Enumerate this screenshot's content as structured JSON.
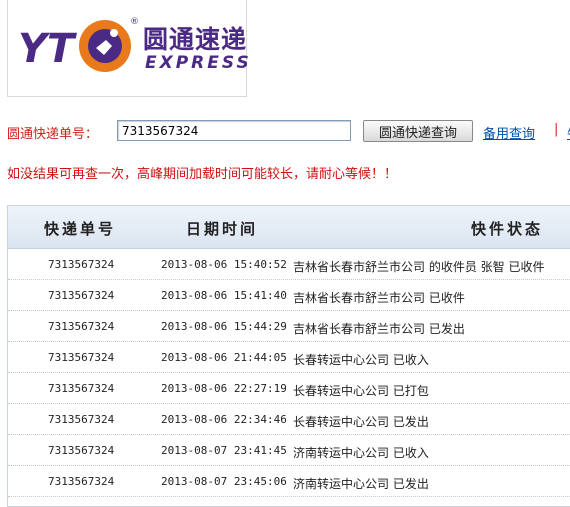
{
  "brand": {
    "logo_mark": "YT",
    "name_cn": "圆通速递",
    "name_en": "EXPRESS",
    "colors": {
      "purple": "#4b2a86",
      "orange": "#e87a1b"
    }
  },
  "search": {
    "label": "圆通快递单号：",
    "value": "7313567324",
    "button_label": "圆通快递查询",
    "backup_link": "备用查询",
    "separator": "|",
    "extra_link": "牛"
  },
  "notice": "如没结果可再查一次，高峰期间加载时间可能较长，请耐心等候！！",
  "table": {
    "headers": [
      "快递单号",
      "日期时间",
      "快件状态"
    ],
    "rows": [
      {
        "no": "7313567324",
        "time": "2013-08-06 15:40:52",
        "status": "吉林省长春市舒兰市公司 的收件员 张智 已收件"
      },
      {
        "no": "7313567324",
        "time": "2013-08-06 15:41:40",
        "status": "吉林省长春市舒兰市公司 已收件"
      },
      {
        "no": "7313567324",
        "time": "2013-08-06 15:44:29",
        "status": "吉林省长春市舒兰市公司 已发出"
      },
      {
        "no": "7313567324",
        "time": "2013-08-06 21:44:05",
        "status": "长春转运中心公司 已收入"
      },
      {
        "no": "7313567324",
        "time": "2013-08-06 22:27:19",
        "status": "长春转运中心公司 已打包"
      },
      {
        "no": "7313567324",
        "time": "2013-08-06 22:34:46",
        "status": "长春转运中心公司 已发出"
      },
      {
        "no": "7313567324",
        "time": "2013-08-07 23:41:45",
        "status": "济南转运中心公司 已收入"
      },
      {
        "no": "7313567324",
        "time": "2013-08-07 23:45:06",
        "status": "济南转运中心公司 已发出"
      }
    ]
  }
}
